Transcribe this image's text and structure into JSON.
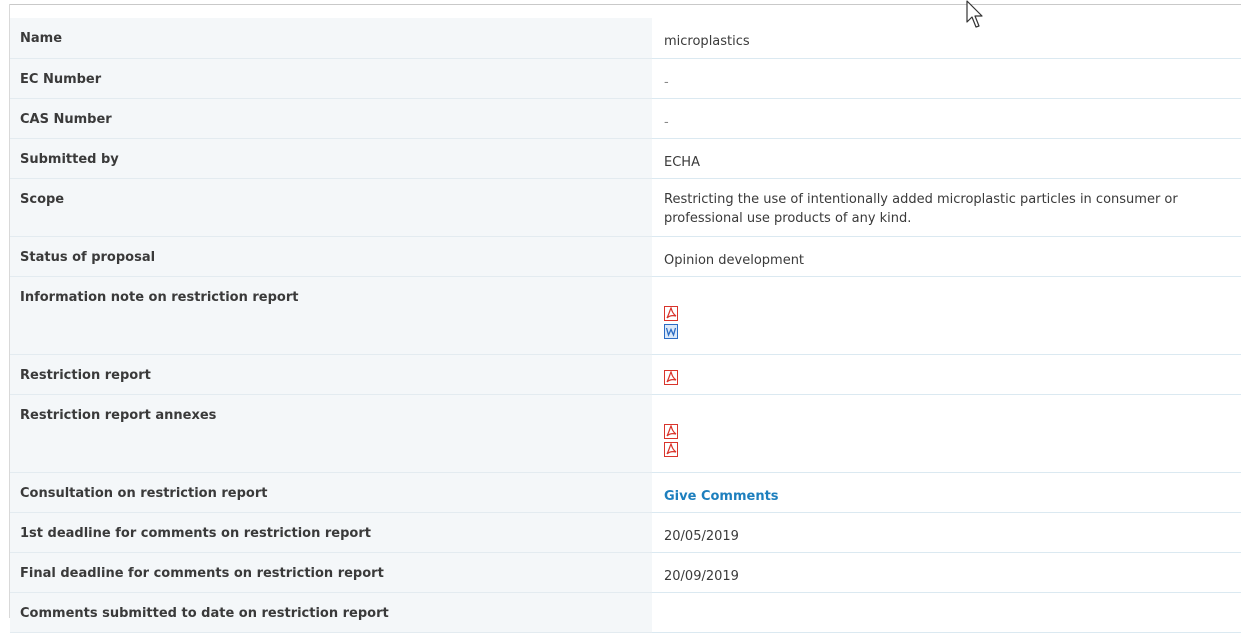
{
  "rows": [
    {
      "label": "Name",
      "value": "microplastics"
    },
    {
      "label": "EC Number",
      "value": "-"
    },
    {
      "label": "CAS Number",
      "value": "-"
    },
    {
      "label": "Submitted by",
      "value": "ECHA"
    },
    {
      "label": "Scope",
      "value": "Restricting the use of intentionally added microplastic particles in consumer or professional use products of any kind."
    },
    {
      "label": "Status of proposal",
      "value": "Opinion development"
    },
    {
      "label": "Information note on restriction report",
      "icons": [
        "pdf-icon",
        "word-icon"
      ]
    },
    {
      "label": "Restriction report",
      "icons": [
        "pdf-icon"
      ]
    },
    {
      "label": "Restriction report annexes",
      "icons": [
        "pdf-icon",
        "pdf-icon"
      ]
    },
    {
      "label": "Consultation on restriction report",
      "link": "Give Comments"
    },
    {
      "label": "1st deadline for comments on restriction report",
      "value": "20/05/2019"
    },
    {
      "label": "Final deadline for comments on restriction report",
      "value": "20/09/2019"
    },
    {
      "label": "Comments submitted to date on restriction report",
      "value": ""
    }
  ],
  "colors": {
    "label_bg": "#f4f7f9",
    "link": "#1d7fbe",
    "pdf_icon": "#d9342b",
    "word_icon": "#2b6cc4"
  }
}
